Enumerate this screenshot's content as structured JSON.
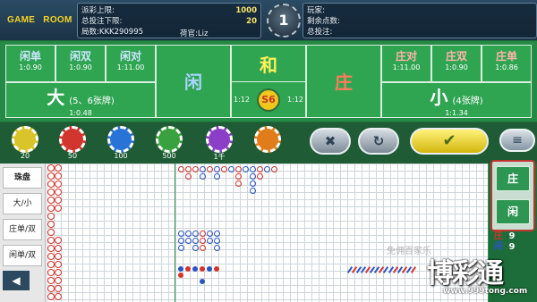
{
  "header": {
    "logo_word1": "GAME",
    "logo_word2": "ROOM",
    "left": {
      "row1_label": "派彩上限:",
      "row1_value": "1000",
      "row2_label": "总投注下限:",
      "row2_value": "20",
      "row3_label": "局数:KKK290995",
      "dealer": "荷官:Liz"
    },
    "round_number": "1",
    "right": {
      "row1_label": "玩家:",
      "row2_label": "剩余点数:",
      "row3_label": "总投注:"
    }
  },
  "bets": {
    "player_single": {
      "name": "闲单",
      "odds": "1:0.90"
    },
    "player_double": {
      "name": "闲双",
      "odds": "1:0.90"
    },
    "player_pair": {
      "name": "闲对",
      "odds": "1:11.00"
    },
    "big": {
      "name": "大",
      "sub": "(5、6张牌)",
      "odds": "1:0.48"
    },
    "player": {
      "name": "闲"
    },
    "tie": {
      "name": "和",
      "odds_left": "1:12",
      "odds_right": "1:12",
      "badge": "S6"
    },
    "banker": {
      "name": "庄"
    },
    "banker_pair": {
      "name": "庄对",
      "odds": "1:11.00"
    },
    "banker_double": {
      "name": "庄双",
      "odds": "1:0.90"
    },
    "banker_single": {
      "name": "庄单",
      "odds": "1:0.86"
    },
    "small": {
      "name": "小",
      "sub": "(4张牌)",
      "odds": "1:1.34"
    }
  },
  "chips": [
    {
      "label": "20",
      "color": "#d9c42a"
    },
    {
      "label": "50",
      "color": "#d2342e"
    },
    {
      "label": "100",
      "color": "#2a73d6"
    },
    {
      "label": "500",
      "color": "#39a13e"
    },
    {
      "label": "1千",
      "color": "#8b3ec6"
    },
    {
      "label": "",
      "color": "#e07d1a"
    }
  ],
  "controls": {
    "cancel": "✖",
    "repeat": "↻",
    "confirm": "✔",
    "menu": "≡"
  },
  "road_tabs": {
    "bead": "珠盘",
    "big_small": "大/小",
    "banker_odd_even": "庄单/双",
    "player_odd_even": "闲单/双",
    "back": "◀"
  },
  "watermark": "免佣百家乐",
  "ask_road": {
    "banker": "庄",
    "player": "闲"
  },
  "stats": [
    {
      "label": "庄",
      "value": "9",
      "color": "#d4342b"
    },
    {
      "label": "闲",
      "value": "9",
      "color": "#2955c4"
    }
  ],
  "brand": {
    "name": "博彩通",
    "url": "www.999tong.com"
  },
  "colors": {
    "banker": "#d4342b",
    "player": "#2955c4",
    "table": "#2fa552",
    "header": "#1c3346"
  }
}
